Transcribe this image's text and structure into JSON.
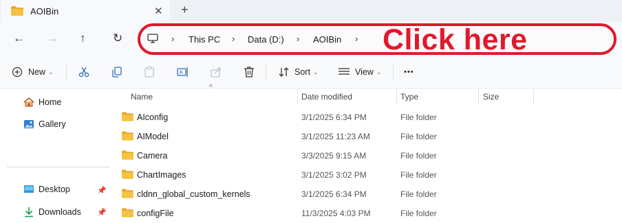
{
  "tab": {
    "title": "AOIBin",
    "close": "✕",
    "new_tab": "+"
  },
  "nav": {
    "back": "←",
    "forward": "→",
    "up": "↑",
    "refresh": "↻"
  },
  "address": {
    "crumbs": [
      "This PC",
      "Data (D:)",
      "AOIBin"
    ],
    "separator": "›",
    "annotation": "Click here"
  },
  "toolbar": {
    "new_label": "New",
    "sort_label": "Sort",
    "view_label": "View",
    "more_label": "•••",
    "caret": "⌄"
  },
  "sidebar": {
    "items": [
      {
        "label": "Home",
        "icon": "home-icon"
      },
      {
        "label": "Gallery",
        "icon": "gallery-icon"
      },
      {
        "label": "Desktop",
        "icon": "desktop-icon",
        "pinned": true
      },
      {
        "label": "Downloads",
        "icon": "download-icon",
        "pinned": true
      }
    ],
    "pin_glyph": "📌"
  },
  "columns": {
    "name": "Name",
    "date": "Date modified",
    "type": "Type",
    "size": "Size",
    "sort_glyph": "^"
  },
  "files": [
    {
      "name": "AIconfig",
      "date": "3/1/2025 6:34 PM",
      "type": "File folder",
      "size": ""
    },
    {
      "name": "AIModel",
      "date": "3/1/2025 11:23 AM",
      "type": "File folder",
      "size": ""
    },
    {
      "name": "Camera",
      "date": "3/3/2025 9:15 AM",
      "type": "File folder",
      "size": ""
    },
    {
      "name": "ChartImages",
      "date": "3/1/2025 3:02 PM",
      "type": "File folder",
      "size": ""
    },
    {
      "name": "cldnn_global_custom_kernels",
      "date": "3/1/2025 6:34 PM",
      "type": "File folder",
      "size": ""
    },
    {
      "name": "configFile",
      "date": "11/3/2025 4:03 PM",
      "type": "File folder",
      "size": ""
    }
  ],
  "colors": {
    "annotation": "#e0192d",
    "folder": "#f5c343",
    "folder_dark": "#e8a92a"
  }
}
